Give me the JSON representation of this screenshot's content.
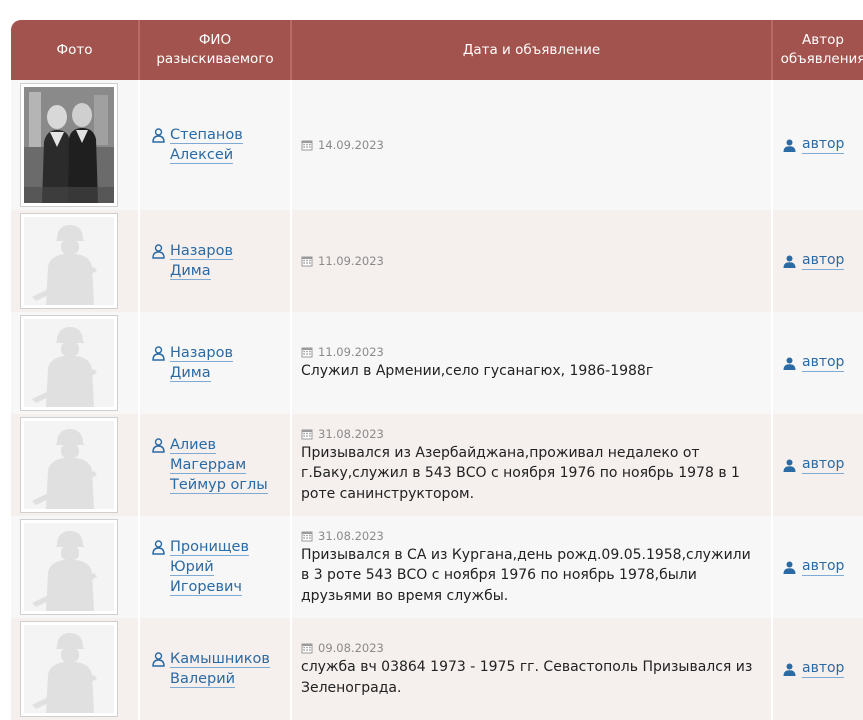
{
  "header": {
    "photo": "Фото",
    "name_line1": "ФИО",
    "name_line2": "разыскиваемого",
    "desc": "Дата и объявление",
    "author_line1": "Автор",
    "author_line2": "объявления"
  },
  "rows": [
    {
      "photo": "real-photo",
      "name_lines": [
        "Степанов",
        "Алексей",
        ""
      ],
      "date": "14.09.2023",
      "text": "",
      "author": "автор"
    },
    {
      "photo": "placeholder-soldier",
      "name_lines": [
        "Назаров",
        "Дима",
        ""
      ],
      "date": "11.09.2023",
      "text": "",
      "author": "автор"
    },
    {
      "photo": "placeholder-soldier",
      "name_lines": [
        "Назаров",
        "Дима",
        ""
      ],
      "date": "11.09.2023",
      "text": "Служил в Армении,село гусанагюх, 1986-1988г",
      "author": "автор"
    },
    {
      "photo": "placeholder-soldier",
      "name_lines": [
        "Алиев",
        "Магеррам",
        "Теймур оглы"
      ],
      "date": "31.08.2023",
      "text": "Призывался из Азербайджана,проживал недалеко от г.Баку,служил в 543 ВСО с ноября 1976 по ноябрь 1978 в 1 роте санинструктором.",
      "author": "автор"
    },
    {
      "photo": "placeholder-soldier",
      "name_lines": [
        "Пронищев",
        "Юрий",
        "Игоревич"
      ],
      "date": "31.08.2023",
      "text": "Призывался в СА из Кургана,день рожд.09.05.1958,служили в 3 роте 543 ВСО с ноября 1976 по ноябрь 1978,были друзьями во время службы.",
      "author": "автор"
    },
    {
      "photo": "placeholder-soldier",
      "name_lines": [
        "Камышников",
        "Валерий",
        ""
      ],
      "date": "09.08.2023",
      "text": "служба вч 03864 1973 - 1975 гг. Севастополь Призывался из Зеленограда.",
      "author": "автор"
    }
  ],
  "colors": {
    "header_bg": "#a3534d",
    "link": "#2b6aa3",
    "row_odd": "#f7f7f7",
    "row_even": "#f5efee"
  }
}
